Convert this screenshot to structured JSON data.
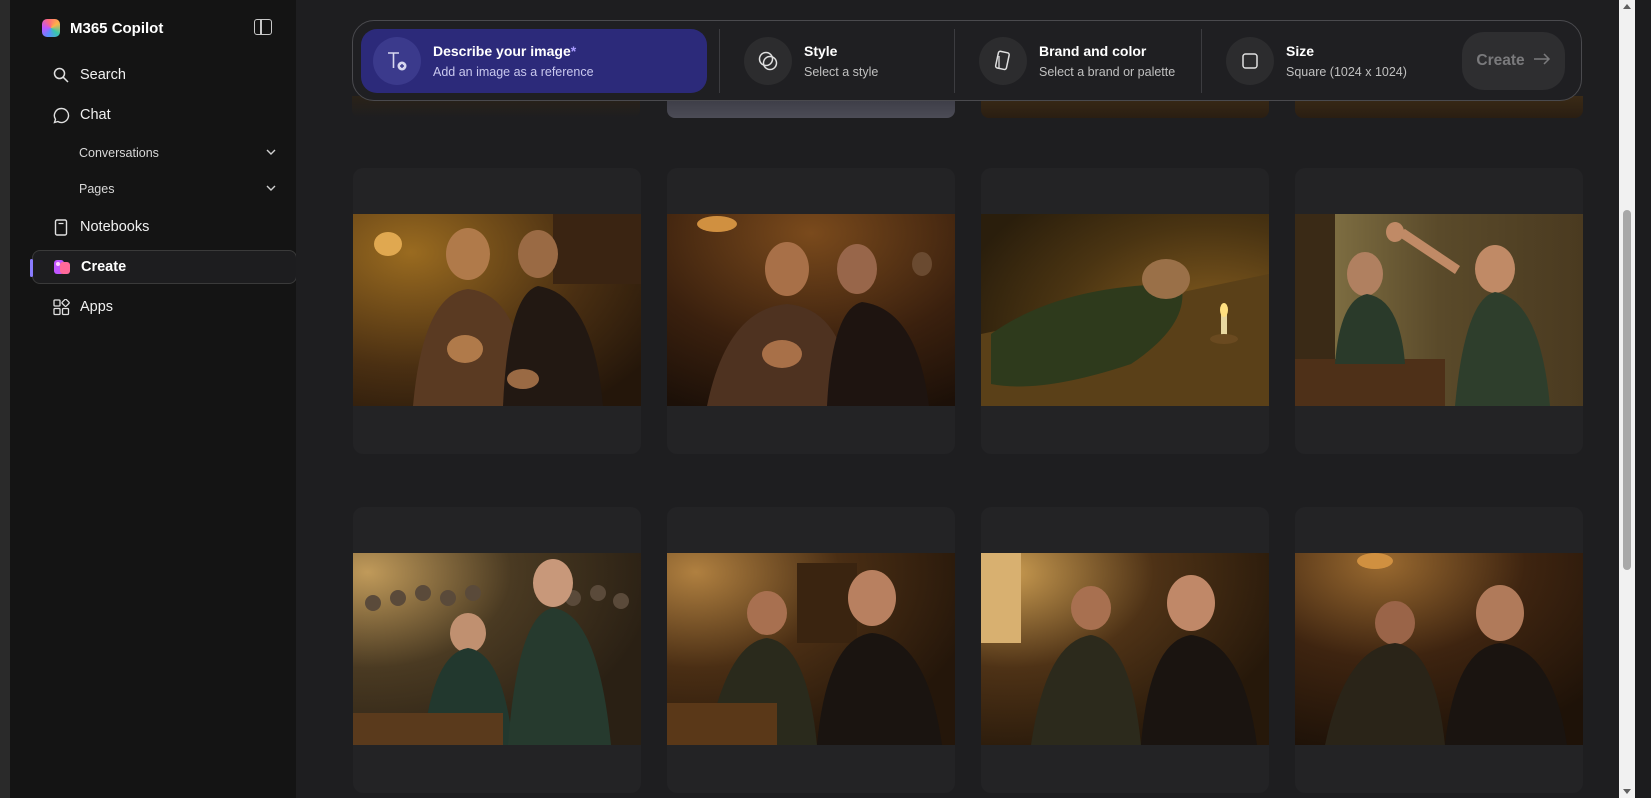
{
  "app": {
    "title": "M365 Copilot"
  },
  "sidebar": {
    "items": [
      {
        "label": "Search",
        "icon": "search-icon"
      },
      {
        "label": "Chat",
        "icon": "chat-icon"
      },
      {
        "label": "Conversations",
        "icon": "chevron-down-icon"
      },
      {
        "label": "Pages",
        "icon": "chevron-down-icon"
      },
      {
        "label": "Notebooks",
        "icon": "notebook-icon"
      },
      {
        "label": "Create",
        "icon": "create-icon",
        "active": true
      },
      {
        "label": "Apps",
        "icon": "apps-icon"
      }
    ]
  },
  "toolbar": {
    "describe": {
      "label": "Describe your image",
      "required": "*",
      "sub": "Add an image as a reference",
      "icon": "text-add-image-icon"
    },
    "style": {
      "label": "Style",
      "sub": "Select a style",
      "icon": "style-icon"
    },
    "brand": {
      "label": "Brand and color",
      "sub": "Select a brand or palette",
      "icon": "brand-icon"
    },
    "size": {
      "label": "Size",
      "sub": "Square (1024 x 1024)",
      "icon": "square-icon"
    },
    "create_label": "Create"
  },
  "colors": {
    "accent": "#2c2a7a",
    "active_bar": "#8a7cff",
    "background": "#1e1e20",
    "sidebar": "#141414"
  },
  "gallery": {
    "rows": [
      {
        "images": [
          {
            "name": "elderly-man-and-woman-worried-1"
          },
          {
            "name": "elderly-man-and-woman-worried-2"
          },
          {
            "name": "officer-lying-by-candle"
          },
          {
            "name": "officer-shouting-at-kneeling-man"
          }
        ]
      },
      {
        "images": [
          {
            "name": "officer-with-crowd-kneeling-man"
          },
          {
            "name": "two-officers-in-study-1"
          },
          {
            "name": "two-officers-in-study-2"
          },
          {
            "name": "two-officers-in-study-3"
          }
        ]
      }
    ]
  }
}
